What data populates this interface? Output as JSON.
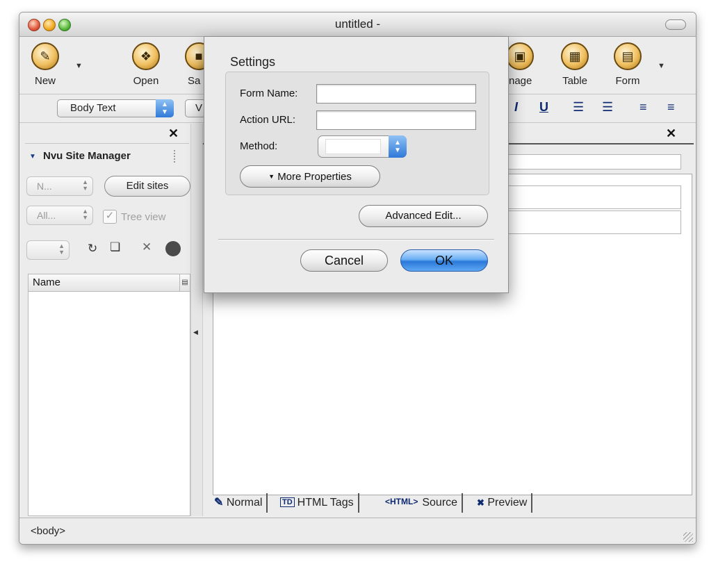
{
  "window": {
    "title": "untitled -"
  },
  "toolbar": {
    "buttons": [
      {
        "label": "New",
        "icon": "new-page-icon"
      },
      {
        "label": "Open",
        "icon": "open-folder-icon"
      },
      {
        "label": "Sa",
        "icon": "save-disk-icon"
      },
      {
        "label": "nage",
        "icon": "image-icon"
      },
      {
        "label": "Table",
        "icon": "table-icon"
      },
      {
        "label": "Form",
        "icon": "form-icon"
      }
    ]
  },
  "format_bar": {
    "paragraph_style": "Body Text",
    "font_partial": "V",
    "glyphs": [
      "I",
      "U"
    ]
  },
  "site_manager": {
    "title": "Nvu Site Manager",
    "site_select": "N...",
    "edit_sites_label": "Edit sites",
    "filter_select": "All...",
    "tree_view_label": "Tree view",
    "tree_view_checked": true,
    "column_header": "Name"
  },
  "mode_tabs": [
    {
      "label": "Normal",
      "icon": "pencil-icon"
    },
    {
      "label": "HTML Tags",
      "icon_text": "TD"
    },
    {
      "label": "Source",
      "icon_text": "<HTML>"
    },
    {
      "label": "Preview",
      "icon": "preview-icon"
    }
  ],
  "status": {
    "text": "<body>"
  },
  "dialog": {
    "title": "Settings",
    "form_name_label": "Form Name:",
    "form_name_value": "",
    "action_url_label": "Action URL:",
    "action_url_value": "",
    "method_label": "Method:",
    "method_value": "",
    "more_properties_label": "More Properties",
    "advanced_edit_label": "Advanced Edit...",
    "cancel_label": "Cancel",
    "ok_label": "OK"
  },
  "colors": {
    "accent_blue": "#2f79d8",
    "window_bg": "#ececec"
  }
}
